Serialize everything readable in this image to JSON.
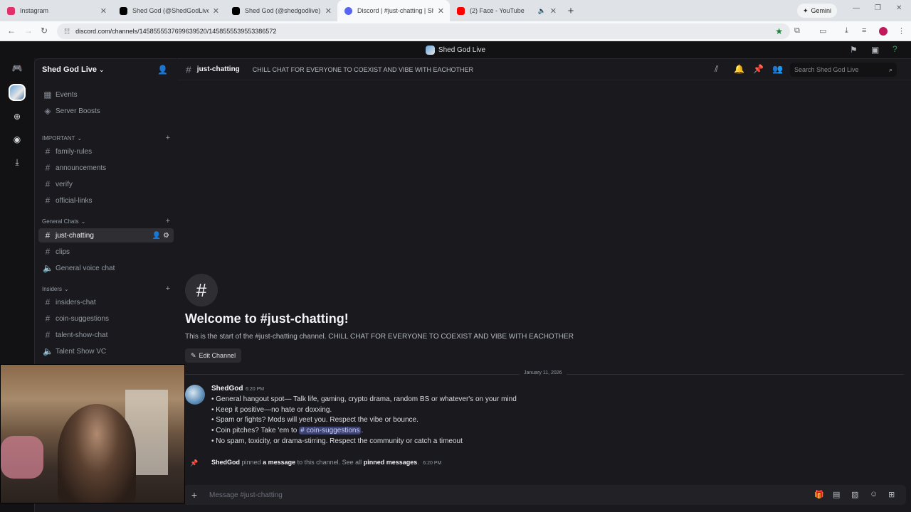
{
  "browser": {
    "tabs": [
      {
        "title": "Instagram",
        "color": "#e1306c"
      },
      {
        "title": "Shed God (@ShedGodLive) / X",
        "color": "#000000"
      },
      {
        "title": "Shed God (@shedgodlive) | Tik",
        "color": "#000000"
      },
      {
        "title": "Discord | #just-chatting | Shed",
        "color": "#5865f2"
      },
      {
        "title": "(2) Face - YouTube",
        "color": "#ff0000"
      }
    ],
    "gemini_label": "Gemini",
    "url": "discord.com/channels/1458555537699639520/1458555539553386572"
  },
  "discord": {
    "top_title": "Shed God Live",
    "server_name": "Shed God Live",
    "sidebar": {
      "events": "Events",
      "boosts": "Server Boosts",
      "cat_important": "IMPORTANT",
      "important": [
        "family-rules",
        "announcements",
        "verify",
        "official-links"
      ],
      "cat_general": "General Chats",
      "general": [
        "just-chatting",
        "clips",
        "General voice chat"
      ],
      "cat_insiders": "Insiders",
      "insiders": [
        "insiders-chat",
        "coin-suggestions",
        "talent-show-chat",
        "Talent Show VC"
      ]
    },
    "channel": {
      "name": "just-chatting",
      "topic": "CHILL CHAT FOR EVERYONE TO COEXIST AND VIBE WITH EACHOTHER",
      "search_placeholder": "Search Shed God Live"
    },
    "welcome": {
      "title": "Welcome to #just-chatting!",
      "subtitle": "This is the start of the #just-chatting channel. CHILL CHAT FOR EVERYONE TO COEXIST AND VIBE WITH EACHOTHER",
      "edit_label": "Edit Channel"
    },
    "date_divider": "January 11, 2026",
    "message": {
      "author": "ShedGod",
      "time": "6:20 PM",
      "line1": "• General hangout spot— Talk life, gaming, crypto drama, random BS or whatever's on your mind",
      "line2": "• Keep it positive—no hate or doxxing.",
      "line3": "• Spam or fights? Mods will yeet you. Respect the vibe or bounce.",
      "line4_prefix": "• Coin pitches? Take 'em to",
      "line4_mention": "# coin-suggestions",
      "line4_suffix": ".",
      "line5": "• No spam, toxicity, or drama-stirring. Respect the community or catch a timeout"
    },
    "pin": {
      "author": "ShedGod",
      "t1": "pinned",
      "link1": "a message",
      "t2": "to this channel. See all",
      "link2": "pinned messages",
      "t3": ".",
      "time": "6:20 PM"
    },
    "composer_placeholder": "Message #just-chatting"
  }
}
